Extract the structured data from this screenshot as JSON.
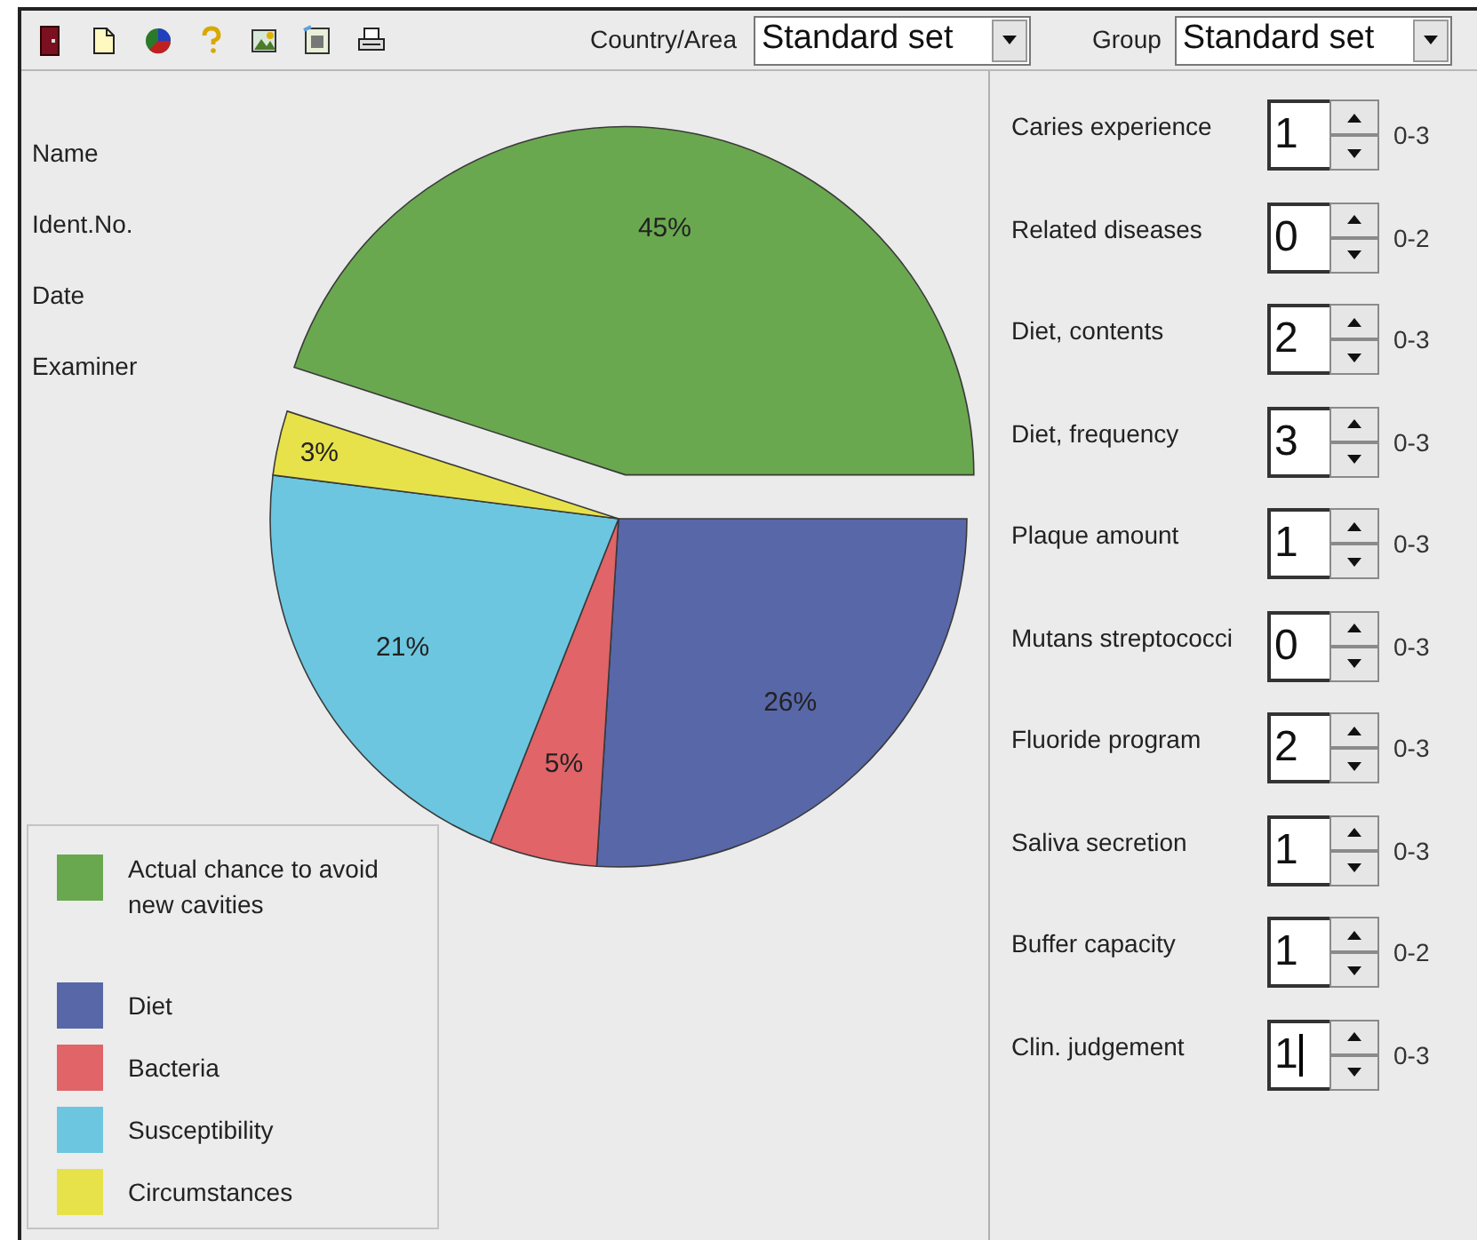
{
  "toolbar": {
    "icons": [
      {
        "kind": "door"
      },
      {
        "kind": "document"
      },
      {
        "kind": "pie"
      },
      {
        "kind": "help"
      },
      {
        "kind": "picture-a"
      },
      {
        "kind": "picture-b"
      },
      {
        "kind": "printer"
      }
    ],
    "selectors": [
      {
        "label": "Country/Area",
        "value": "Standard set"
      },
      {
        "label": "Group",
        "value": "Standard set"
      }
    ]
  },
  "patient_fields": [
    "Name",
    "Ident.No.",
    "Date",
    "Examiner"
  ],
  "chart_data": {
    "type": "pie",
    "categories": [
      "Actual chance to avoid new cavities",
      "Diet",
      "Bacteria",
      "Susceptibility",
      "Circumstances"
    ],
    "values": [
      45,
      26,
      5,
      21,
      3
    ],
    "colors": [
      "#6aa84f",
      "#5867a8",
      "#e06468",
      "#6cc6e0",
      "#e8e24a"
    ],
    "value_labels": [
      "45%",
      "26%",
      "5%",
      "21%",
      "3%"
    ]
  },
  "exploded_slices": [
    true,
    false,
    false,
    false,
    false
  ],
  "factors": [
    {
      "label": "Caries experience",
      "value": "1",
      "range": "0-3",
      "focused": false
    },
    {
      "label": "Related diseases",
      "value": "0",
      "range": "0-2",
      "focused": false
    },
    {
      "label": "Diet, contents",
      "value": "2",
      "range": "0-3",
      "focused": false
    },
    {
      "label": "Diet, frequency",
      "value": "3",
      "range": "0-3",
      "focused": false
    },
    {
      "label": "Plaque amount",
      "value": "1",
      "range": "0-3",
      "focused": false
    },
    {
      "label": "Mutans streptococci",
      "value": "0",
      "range": "0-3",
      "focused": false
    },
    {
      "label": "Fluoride program",
      "value": "2",
      "range": "0-3",
      "focused": false
    },
    {
      "label": "Saliva secretion",
      "value": "1",
      "range": "0-3",
      "focused": false
    },
    {
      "label": "Buffer capacity",
      "value": "1",
      "range": "0-2",
      "focused": false
    },
    {
      "label": "Clin. judgement",
      "value": "1",
      "range": "0-3",
      "focused": true
    }
  ]
}
